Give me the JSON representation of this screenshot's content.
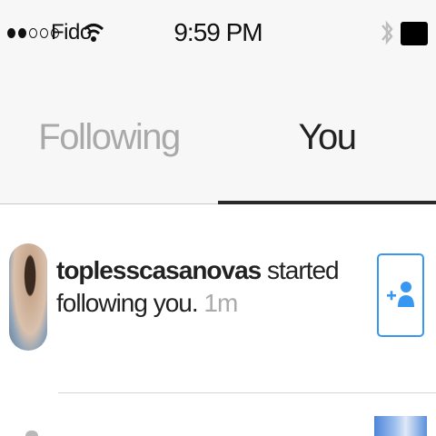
{
  "status_bar": {
    "carrier": "Fido",
    "time": "9:59 PM",
    "signal_bars_filled": 2,
    "signal_bars_total": 5
  },
  "tabs": [
    {
      "label": "Following",
      "active": false
    },
    {
      "label": "You",
      "active": true
    }
  ],
  "notifications": [
    {
      "username": "toplesscasanovas",
      "action": " started following you.",
      "time_ago": " 1m",
      "button_icon": "add-user-icon"
    }
  ],
  "colors": {
    "accent": "#3897f0",
    "inactive_tab": "#a9a9a9",
    "active_tab": "#222222",
    "background": "#f7f7f7"
  }
}
